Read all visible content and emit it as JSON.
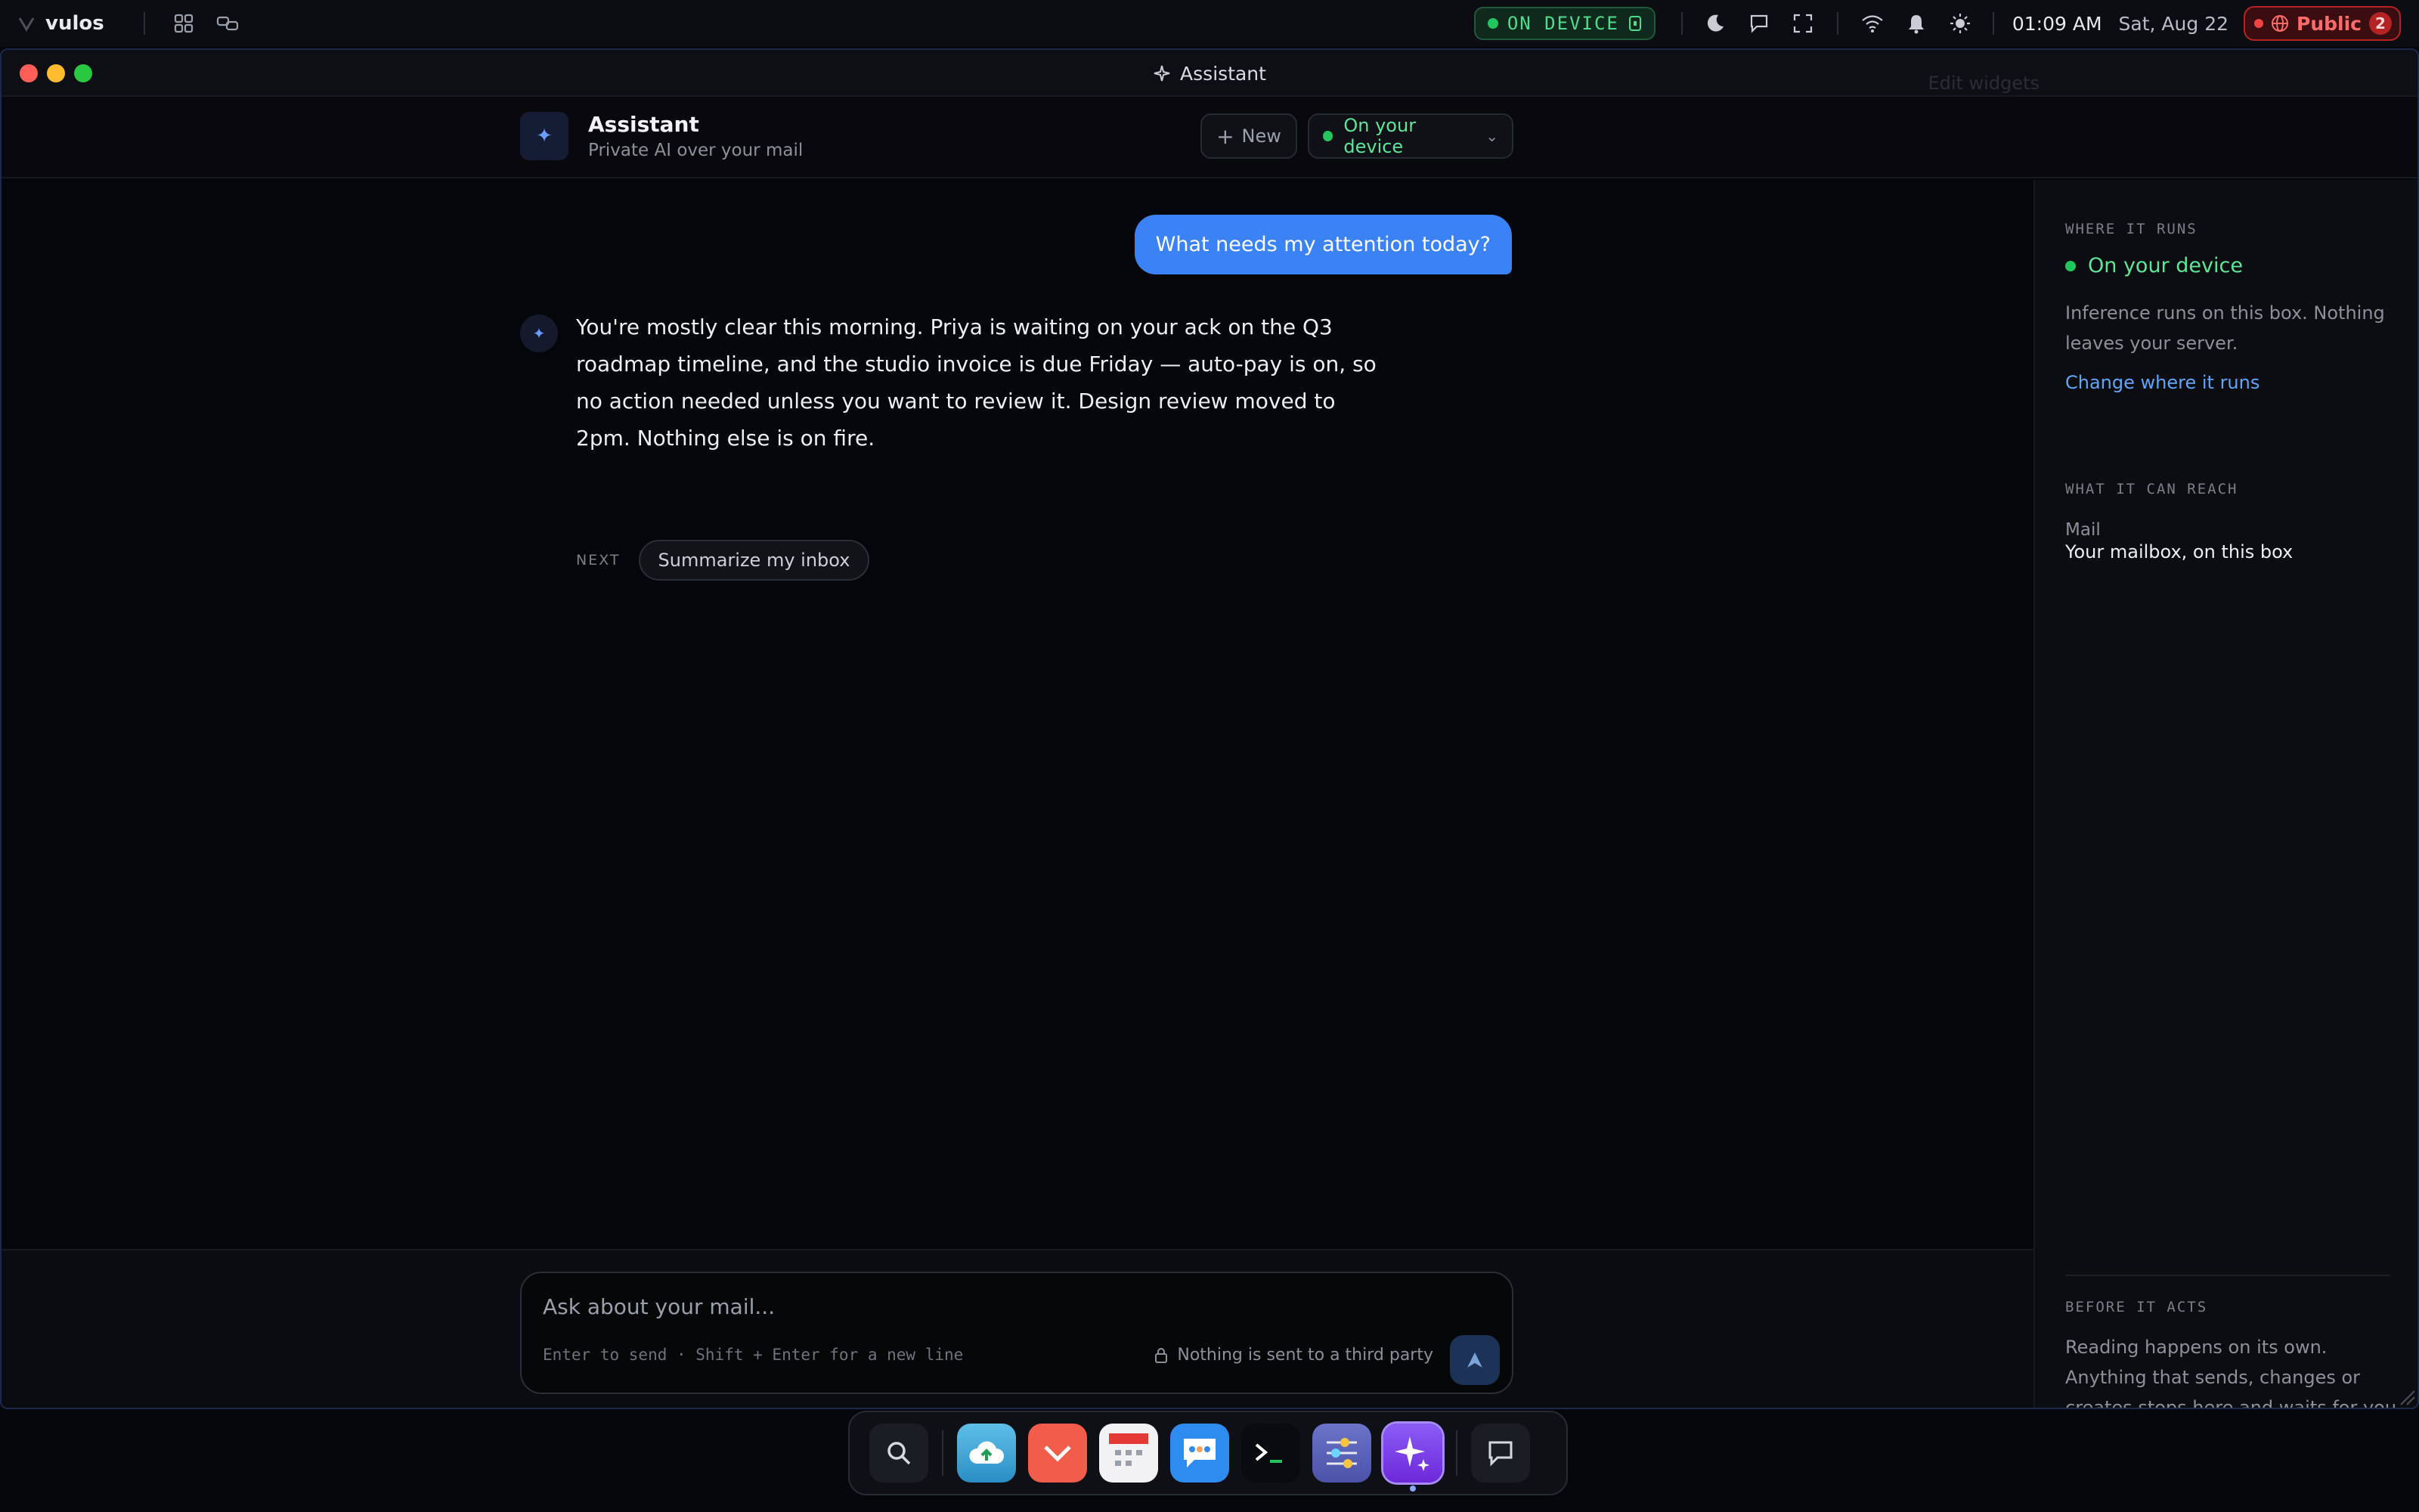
{
  "menubar": {
    "brand": "vulos",
    "device_status": "ON DEVICE",
    "time": "01:09 AM",
    "date": "Sat, Aug 22",
    "public_label": "Public",
    "public_count": "2"
  },
  "window": {
    "title": "Assistant",
    "ghost_text": "Edit widgets"
  },
  "header": {
    "title": "Assistant",
    "subtitle": "Private AI over your mail",
    "new_label": "New",
    "device_label": "On your device"
  },
  "chat": {
    "user_message": "What needs my attention today?",
    "assistant_message": "You're mostly clear this morning. Priya is waiting on your ack on the Q3 roadmap timeline, and the studio invoice is due Friday — auto-pay is on, so no action needed unless you want to review it. Design review moved to 2pm. Nothing else is on fire.",
    "next_label": "NEXT",
    "suggestion": "Summarize my inbox"
  },
  "composer": {
    "placeholder": "Ask about your mail...",
    "hint": "Enter to send · Shift + Enter for a new line",
    "privacy": "Nothing is sent to a third party"
  },
  "sidebar": {
    "where_label": "WHERE IT RUNS",
    "device": "On your device",
    "description": "Inference runs on this box. Nothing leaves your server.",
    "change_link": "Change where it runs",
    "reach_label": "WHAT IT CAN REACH",
    "mail_label": "Mail",
    "mail_value": "Your mailbox, on this box",
    "before_label": "BEFORE IT ACTS",
    "before_text": "Reading happens on its own. Anything that sends, changes or creates stops here and waits for you to approve it."
  },
  "colors": {
    "accent": "#3b82f6",
    "device_green": "#22c55e",
    "public_red": "#ef4444"
  }
}
